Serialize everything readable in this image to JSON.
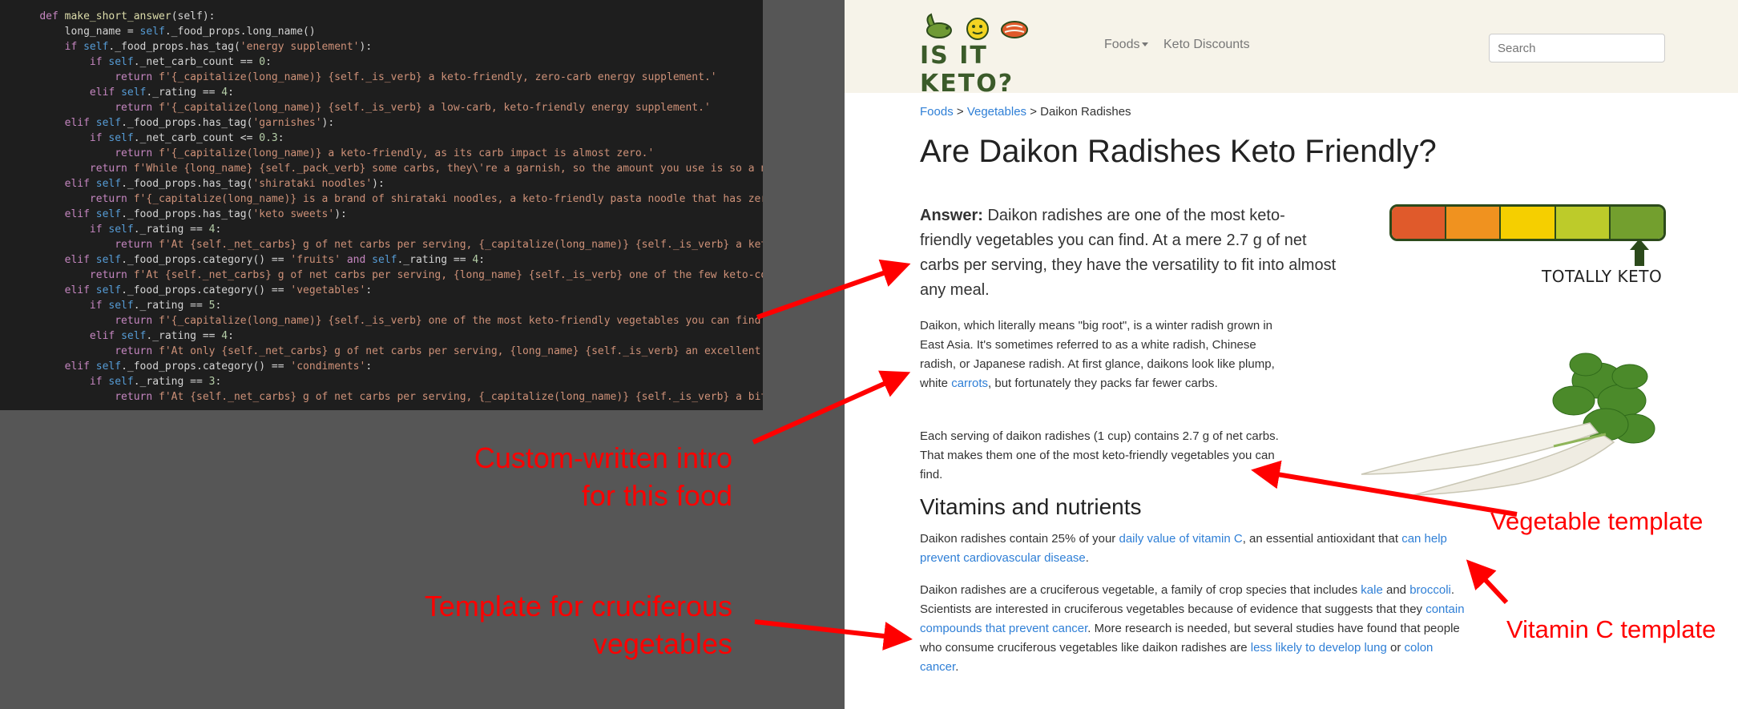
{
  "code_editor": {
    "lines": [
      [
        [
          "    ",
          "txt"
        ],
        [
          "def ",
          "kw"
        ],
        [
          "make_short_answer",
          "fn"
        ],
        [
          "(self):",
          "txt"
        ]
      ],
      [
        [
          "        long_name = ",
          "txt"
        ],
        [
          "self",
          "self"
        ],
        [
          "._food_props.long_name()",
          "txt"
        ]
      ],
      [
        [
          "        ",
          "txt"
        ],
        [
          "if ",
          "kw"
        ],
        [
          "self",
          "self"
        ],
        [
          "._food_props.has_tag(",
          "txt"
        ],
        [
          "'energy supplement'",
          "str"
        ],
        [
          "):",
          "txt"
        ]
      ],
      [
        [
          "            ",
          "txt"
        ],
        [
          "if ",
          "kw"
        ],
        [
          "self",
          "self"
        ],
        [
          "._net_carb_count == ",
          "txt"
        ],
        [
          "0",
          "num"
        ],
        [
          ":",
          "txt"
        ]
      ],
      [
        [
          "                ",
          "txt"
        ],
        [
          "return ",
          "kw"
        ],
        [
          "f'{_capitalize(long_name)} {self._is_verb} a keto-friendly, zero-carb energy supplement.'",
          "str"
        ]
      ],
      [
        [
          "            ",
          "txt"
        ],
        [
          "elif ",
          "kw"
        ],
        [
          "self",
          "self"
        ],
        [
          "._rating == ",
          "txt"
        ],
        [
          "4",
          "num"
        ],
        [
          ":",
          "txt"
        ]
      ],
      [
        [
          "                ",
          "txt"
        ],
        [
          "return ",
          "kw"
        ],
        [
          "f'{_capitalize(long_name)} {self._is_verb} a low-carb, keto-friendly energy supplement.'",
          "str"
        ]
      ],
      [
        [
          "        ",
          "txt"
        ],
        [
          "elif ",
          "kw"
        ],
        [
          "self",
          "self"
        ],
        [
          "._food_props.has_tag(",
          "txt"
        ],
        [
          "'garnishes'",
          "str"
        ],
        [
          "):",
          "txt"
        ]
      ],
      [
        [
          "            ",
          "txt"
        ],
        [
          "if ",
          "kw"
        ],
        [
          "self",
          "self"
        ],
        [
          "._net_carb_count <= ",
          "txt"
        ],
        [
          "0.3",
          "num"
        ],
        [
          ":",
          "txt"
        ]
      ],
      [
        [
          "                ",
          "txt"
        ],
        [
          "return ",
          "kw"
        ],
        [
          "f'{_capitalize(long_name)} a keto-friendly, as its carb impact is almost zero.'",
          "str"
        ]
      ],
      [
        [
          "            ",
          "txt"
        ],
        [
          "return ",
          "kw"
        ],
        [
          "f'While {long_name} {self._pack_verb} some carbs, they\\'re a garnish, so the amount you use is so a no",
          "str"
        ]
      ],
      [
        [
          "        ",
          "txt"
        ],
        [
          "elif ",
          "kw"
        ],
        [
          "self",
          "self"
        ],
        [
          "._food_props.has_tag(",
          "txt"
        ],
        [
          "'shirataki noodles'",
          "str"
        ],
        [
          "):",
          "txt"
        ]
      ],
      [
        [
          "            ",
          "txt"
        ],
        [
          "return ",
          "kw"
        ],
        [
          "f'{_capitalize(long_name)} is a brand of shirataki noodles, a keto-friendly pasta noodle that has zero",
          "str"
        ]
      ],
      [
        [
          "        ",
          "txt"
        ],
        [
          "elif ",
          "kw"
        ],
        [
          "self",
          "self"
        ],
        [
          "._food_props.has_tag(",
          "txt"
        ],
        [
          "'keto sweets'",
          "str"
        ],
        [
          "):",
          "txt"
        ]
      ],
      [
        [
          "            ",
          "txt"
        ],
        [
          "if ",
          "kw"
        ],
        [
          "self",
          "self"
        ],
        [
          "._rating == ",
          "txt"
        ],
        [
          "4",
          "num"
        ],
        [
          ":",
          "txt"
        ]
      ],
      [
        [
          "                ",
          "txt"
        ],
        [
          "return ",
          "kw"
        ],
        [
          "f'At {self._net_carbs} g of net carbs per serving, {_capitalize(long_name)} {self._is_verb} a keto",
          "str"
        ]
      ],
      [
        [
          "        ",
          "txt"
        ],
        [
          "elif ",
          "kw"
        ],
        [
          "self",
          "self"
        ],
        [
          "._food_props.category() == ",
          "txt"
        ],
        [
          "'fruits'",
          "str"
        ],
        [
          " and ",
          "kw"
        ],
        [
          "self",
          "self"
        ],
        [
          "._rating == ",
          "txt"
        ],
        [
          "4",
          "num"
        ],
        [
          ":",
          "txt"
        ]
      ],
      [
        [
          "            ",
          "txt"
        ],
        [
          "return ",
          "kw"
        ],
        [
          "f'At {self._net_carbs} g of net carbs per serving, {long_name} {self._is_verb} one of the few keto-com",
          "str"
        ]
      ],
      [
        [
          "        ",
          "txt"
        ],
        [
          "elif ",
          "kw"
        ],
        [
          "self",
          "self"
        ],
        [
          "._food_props.category() == ",
          "txt"
        ],
        [
          "'vegetables'",
          "str"
        ],
        [
          ":",
          "txt"
        ]
      ],
      [
        [
          "            ",
          "txt"
        ],
        [
          "if ",
          "kw"
        ],
        [
          "self",
          "self"
        ],
        [
          "._rating == ",
          "txt"
        ],
        [
          "5",
          "num"
        ],
        [
          ":",
          "txt"
        ]
      ],
      [
        [
          "                ",
          "txt"
        ],
        [
          "return ",
          "kw"
        ],
        [
          "f'{_capitalize(long_name)} {self._is_verb} one of the most keto-friendly vegetables you can find.",
          "str"
        ]
      ],
      [
        [
          "            ",
          "txt"
        ],
        [
          "elif ",
          "kw"
        ],
        [
          "self",
          "self"
        ],
        [
          "._rating == ",
          "txt"
        ],
        [
          "4",
          "num"
        ],
        [
          ":",
          "txt"
        ]
      ],
      [
        [
          "                ",
          "txt"
        ],
        [
          "return ",
          "kw"
        ],
        [
          "f'At only {self._net_carbs} g of net carbs per serving, {long_name} {self._is_verb} an excellent, k",
          "str"
        ]
      ],
      [
        [
          "        ",
          "txt"
        ],
        [
          "elif ",
          "kw"
        ],
        [
          "self",
          "self"
        ],
        [
          "._food_props.category() == ",
          "txt"
        ],
        [
          "'condiments'",
          "str"
        ],
        [
          ":",
          "txt"
        ]
      ],
      [
        [
          "            ",
          "txt"
        ],
        [
          "if ",
          "kw"
        ],
        [
          "self",
          "self"
        ],
        [
          "._rating == ",
          "txt"
        ],
        [
          "3",
          "num"
        ],
        [
          ":",
          "txt"
        ]
      ],
      [
        [
          "                ",
          "txt"
        ],
        [
          "return ",
          "kw"
        ],
        [
          "f'At {self._net_carbs} g of net carbs per serving, {_capitalize(long_name)} {self._is_verb} a bit",
          "str"
        ]
      ]
    ]
  },
  "site": {
    "logo_text": "IS IT KETO?",
    "nav": {
      "foods": "Foods",
      "discounts": "Keto Discounts"
    },
    "search_placeholder": "Search"
  },
  "breadcrumb": {
    "items": [
      "Foods",
      "Vegetables"
    ],
    "separator": " > ",
    "current": "Daikon Radishes"
  },
  "page": {
    "title": "Are Daikon Radishes Keto Friendly?",
    "answer_label": "Answer:",
    "answer_text": " Daikon radishes are one of the most keto-friendly vegetables you can find. At a mere 2.7 g of net carbs per serving, they have the versatility to fit into almost any meal.",
    "intro": {
      "before": "Daikon, which literally means \"big root\", is a winter radish grown in East Asia. It's sometimes referred to as a white radish, Chinese radish, or Japanese radish. At first glance, daikons look like plump, white ",
      "link": "carrots",
      "after": ", but fortunately they packs far fewer carbs."
    },
    "serving": "Each serving of daikon radishes (1 cup) contains 2.7 g of net carbs. That makes them one of the most keto-friendly vegetables you can find.",
    "vitamins_heading": "Vitamins and nutrients",
    "vitc": {
      "t1": "Daikon radishes contain 25% of your ",
      "l1": "daily value of vitamin C",
      "t2": ", an essential antioxidant that ",
      "l2": "can help prevent cardiovascular disease",
      "t3": "."
    },
    "cruc": {
      "t1": "Daikon radishes are a cruciferous vegetable, a family of crop species that includes ",
      "l1": "kale",
      "t2": " and ",
      "l2": "broccoli",
      "t3": ". Scientists are interested in cruciferous vegetables because of evidence that suggests that they ",
      "l3": "contain compounds that prevent cancer",
      "t4": ". More research is needed, but several studies have found that people who consume cruciferous vegetables like daikon radishes are ",
      "l4": "less likely to develop lung",
      "t5": " or ",
      "l5": "colon cancer",
      "t6": "."
    },
    "meter": {
      "label": "TOTALLY KETO",
      "colors": [
        "#e05a2b",
        "#f0921f",
        "#f5cf00",
        "#bdcb2a",
        "#739f2e"
      ]
    }
  },
  "annotations": {
    "intro": [
      "Custom-written intro",
      "for this food"
    ],
    "cruciferous": [
      "Template for cruciferous",
      "vegetables"
    ],
    "vegetable": "Vegetable template",
    "vitamin_c": "Vitamin C template",
    "color": "#ff0000"
  }
}
